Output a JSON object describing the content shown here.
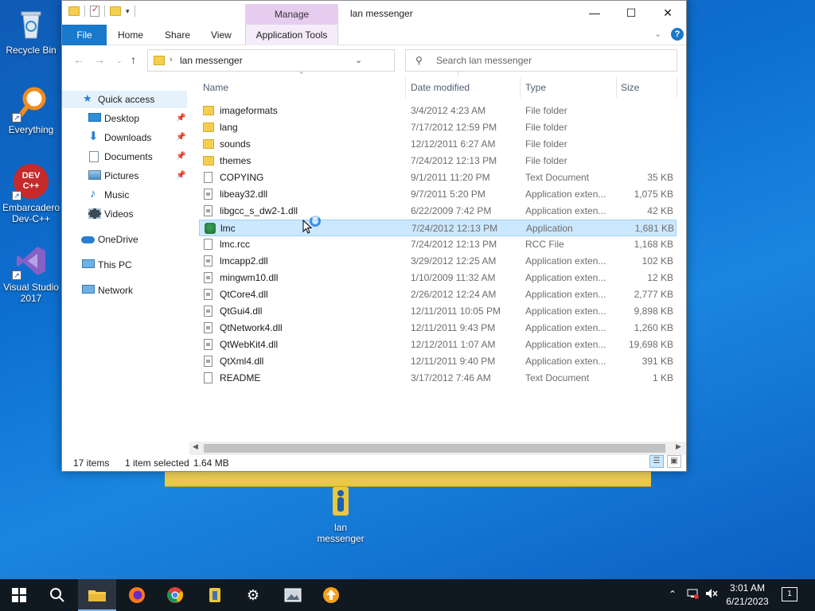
{
  "desktop": {
    "icons": [
      {
        "label": "Recycle Bin"
      },
      {
        "label": "Everything"
      },
      {
        "label": "Embarcadero Dev-C++",
        "badge": "DEV C++"
      },
      {
        "label": "Visual Studio 2017"
      },
      {
        "label": "lan messenger"
      }
    ]
  },
  "window": {
    "title": "lan messenger",
    "manage_tab": "Manage",
    "controls": {
      "minimize": "—",
      "maximize": "☐",
      "close": "✕"
    },
    "ribbon_tabs": [
      "File",
      "Home",
      "Share",
      "View",
      "Application Tools"
    ],
    "help": "?",
    "address": {
      "path": "lan messenger",
      "separator": "›"
    },
    "search": {
      "placeholder": "Search lan messenger"
    },
    "nav": [
      {
        "label": "Quick access",
        "icon": "star-icon",
        "selected": true
      },
      {
        "label": "Desktop",
        "icon": "desktop-icon",
        "pinned": true
      },
      {
        "label": "Downloads",
        "icon": "download-arrow-icon",
        "pinned": true
      },
      {
        "label": "Documents",
        "icon": "documents-icon",
        "pinned": true
      },
      {
        "label": "Pictures",
        "icon": "pictures-icon",
        "pinned": true
      },
      {
        "label": "Music",
        "icon": "music-note-icon"
      },
      {
        "label": "Videos",
        "icon": "film-icon"
      },
      {
        "label": "OneDrive",
        "icon": "cloud-icon"
      },
      {
        "label": "This PC",
        "icon": "computer-icon"
      },
      {
        "label": "Network",
        "icon": "network-icon"
      }
    ],
    "columns": {
      "name": "Name",
      "date": "Date modified",
      "type": "Type",
      "size": "Size"
    },
    "files": [
      {
        "name": "imageformats",
        "date": "3/4/2012 4:23 AM",
        "type": "File folder",
        "size": "",
        "kind": "folder"
      },
      {
        "name": "lang",
        "date": "7/17/2012 12:59 PM",
        "type": "File folder",
        "size": "",
        "kind": "folder"
      },
      {
        "name": "sounds",
        "date": "12/12/2011 6:27 AM",
        "type": "File folder",
        "size": "",
        "kind": "folder"
      },
      {
        "name": "themes",
        "date": "7/24/2012 12:13 PM",
        "type": "File folder",
        "size": "",
        "kind": "folder"
      },
      {
        "name": "COPYING",
        "date": "9/1/2011 11:20 PM",
        "type": "Text Document",
        "size": "35 KB",
        "kind": "doc"
      },
      {
        "name": "libeay32.dll",
        "date": "9/7/2011 5:20 PM",
        "type": "Application exten...",
        "size": "1,075 KB",
        "kind": "dll"
      },
      {
        "name": "libgcc_s_dw2-1.dll",
        "date": "6/22/2009 7:42 PM",
        "type": "Application exten...",
        "size": "42 KB",
        "kind": "dll"
      },
      {
        "name": "lmc",
        "date": "7/24/2012 12:13 PM",
        "type": "Application",
        "size": "1,681 KB",
        "kind": "app",
        "selected": true
      },
      {
        "name": "lmc.rcc",
        "date": "7/24/2012 12:13 PM",
        "type": "RCC File",
        "size": "1,168 KB",
        "kind": "doc"
      },
      {
        "name": "lmcapp2.dll",
        "date": "3/29/2012 12:25 AM",
        "type": "Application exten...",
        "size": "102 KB",
        "kind": "dll"
      },
      {
        "name": "mingwm10.dll",
        "date": "1/10/2009 11:32 AM",
        "type": "Application exten...",
        "size": "12 KB",
        "kind": "dll"
      },
      {
        "name": "QtCore4.dll",
        "date": "2/26/2012 12:24 AM",
        "type": "Application exten...",
        "size": "2,777 KB",
        "kind": "dll"
      },
      {
        "name": "QtGui4.dll",
        "date": "12/11/2011 10:05 PM",
        "type": "Application exten...",
        "size": "9,898 KB",
        "kind": "dll"
      },
      {
        "name": "QtNetwork4.dll",
        "date": "12/11/2011 9:43 PM",
        "type": "Application exten...",
        "size": "1,260 KB",
        "kind": "dll"
      },
      {
        "name": "QtWebKit4.dll",
        "date": "12/12/2011 1:07 AM",
        "type": "Application exten...",
        "size": "19,698 KB",
        "kind": "dll"
      },
      {
        "name": "QtXml4.dll",
        "date": "12/11/2011 9:40 PM",
        "type": "Application exten...",
        "size": "391 KB",
        "kind": "dll"
      },
      {
        "name": "README",
        "date": "3/17/2012 7:46 AM",
        "type": "Text Document",
        "size": "1 KB",
        "kind": "doc"
      }
    ],
    "status": {
      "count": "17 items",
      "selection": "1 item selected",
      "size": "1.64 MB"
    }
  },
  "taskbar": {
    "apps": [
      "start-icon",
      "search-icon",
      "file-explorer-icon",
      "firefox-icon",
      "chrome-icon",
      "folder-app-icon",
      "settings-gear-icon",
      "photos-icon",
      "upload-arrow-icon"
    ],
    "clock": {
      "time": "3:01 AM",
      "date": "6/21/2023"
    },
    "notifications": "1"
  },
  "colors": {
    "accent": "#1979ca",
    "selection": "#cce8ff",
    "taskbar": "#101820"
  }
}
